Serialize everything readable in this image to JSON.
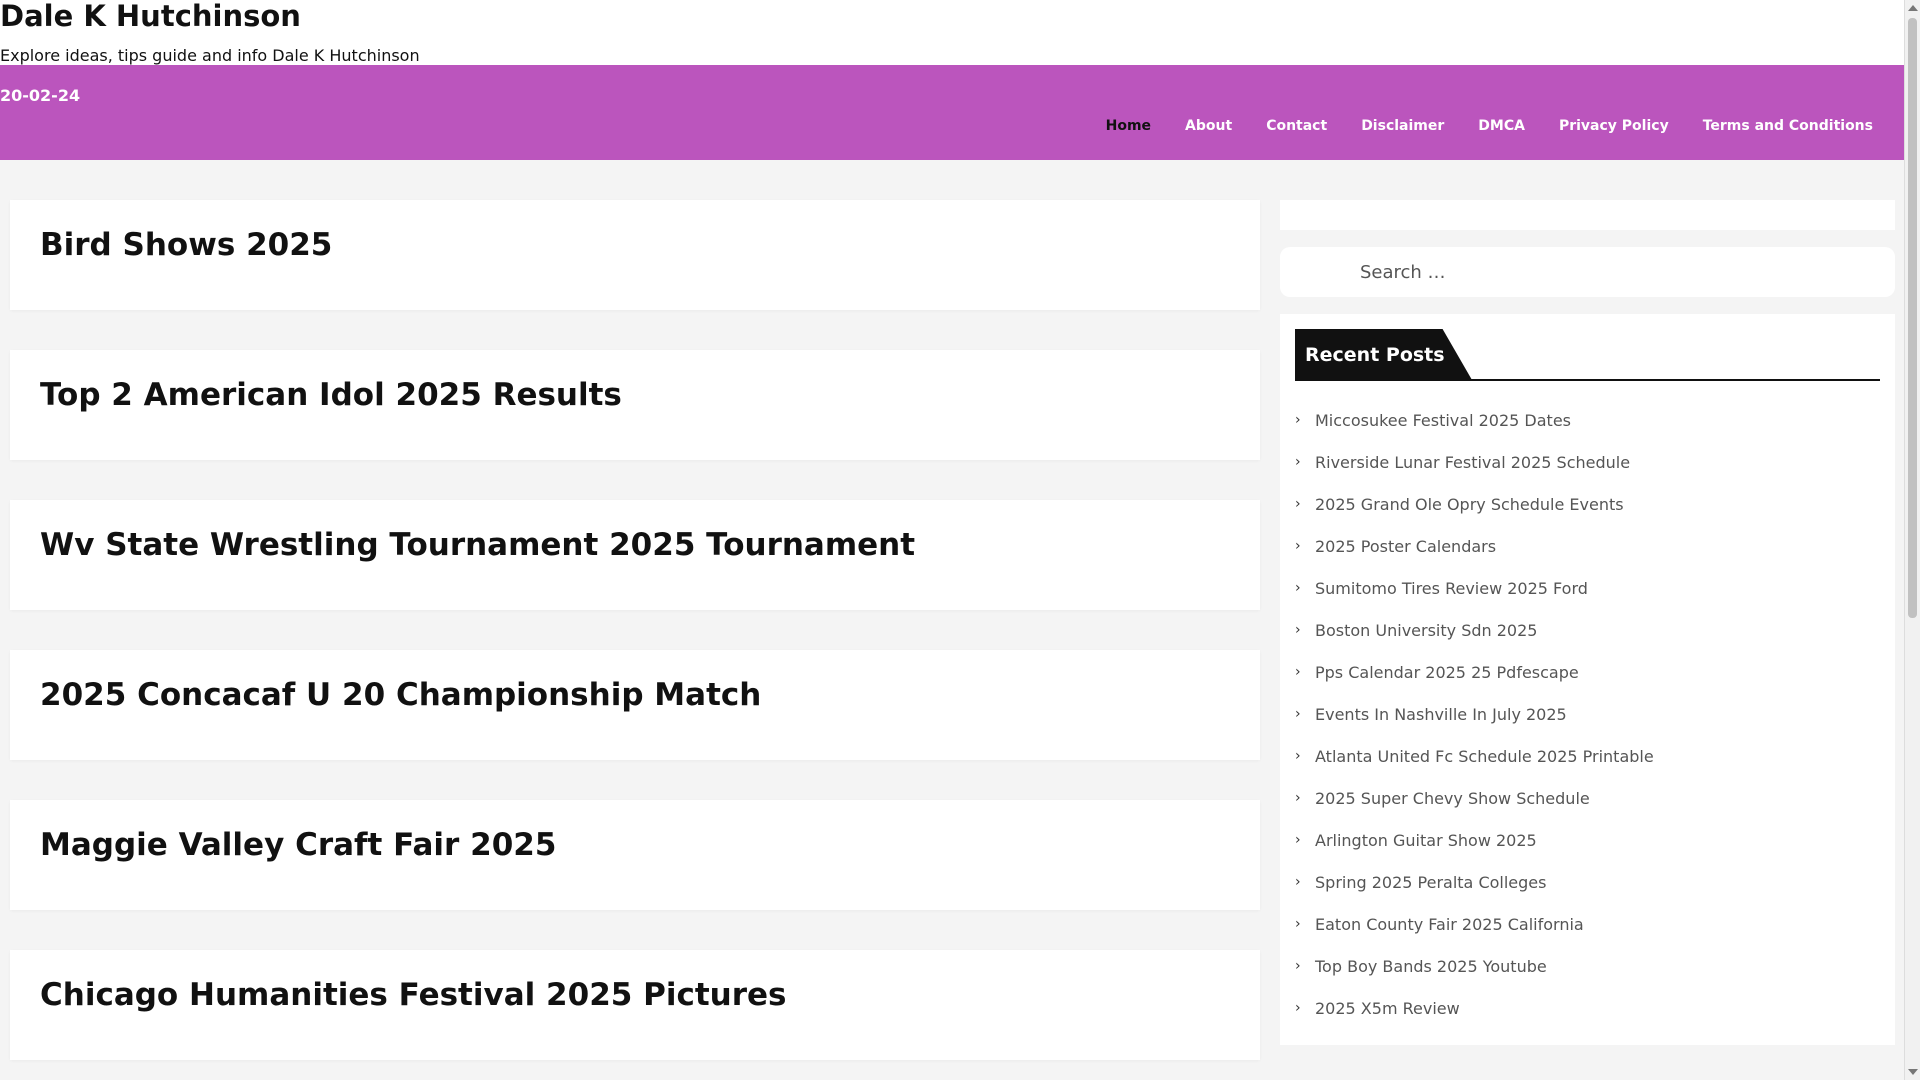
{
  "site": {
    "title": "Dale K Hutchinson",
    "description": "Explore ideas, tips guide and info Dale K Hutchinson"
  },
  "nav": {
    "date": "20-02-24",
    "items": [
      "Home",
      "About",
      "Contact",
      "Disclaimer",
      "DMCA",
      "Privacy Policy",
      "Terms and Conditions"
    ],
    "active": "Home"
  },
  "posts": [
    {
      "title": "Bird Shows 2025"
    },
    {
      "title": "Top 2 American Idol 2025 Results"
    },
    {
      "title": "Wv State Wrestling Tournament 2025 Tournament"
    },
    {
      "title": "2025 Concacaf U 20 Championship Match"
    },
    {
      "title": "Maggie Valley Craft Fair 2025"
    },
    {
      "title": "Chicago Humanities Festival 2025 Pictures"
    }
  ],
  "sidebar": {
    "search": {
      "placeholder": "Search …"
    },
    "recent_title": "Recent Posts",
    "recent_posts": [
      "Miccosukee Festival 2025 Dates",
      "Riverside Lunar Festival 2025 Schedule",
      "2025 Grand Ole Opry Schedule Events",
      "2025 Poster Calendars",
      "Sumitomo Tires Review 2025 Ford",
      "Boston University Sdn 2025",
      "Pps Calendar 2025 25 Pdfescape",
      "Events In Nashville In July 2025",
      "Atlanta United Fc Schedule 2025 Printable",
      "2025 Super Chevy Show Schedule",
      "Arlington Guitar Show 2025",
      "Spring 2025 Peralta Colleges",
      "Eaton County Fair 2025 California",
      "Top Boy Bands 2025 Youtube",
      "2025 X5m Review"
    ]
  },
  "colors": {
    "nav_bg": "#bb55bd",
    "card_bg": "#ffffff",
    "page_bg": "#f4f4f4"
  }
}
